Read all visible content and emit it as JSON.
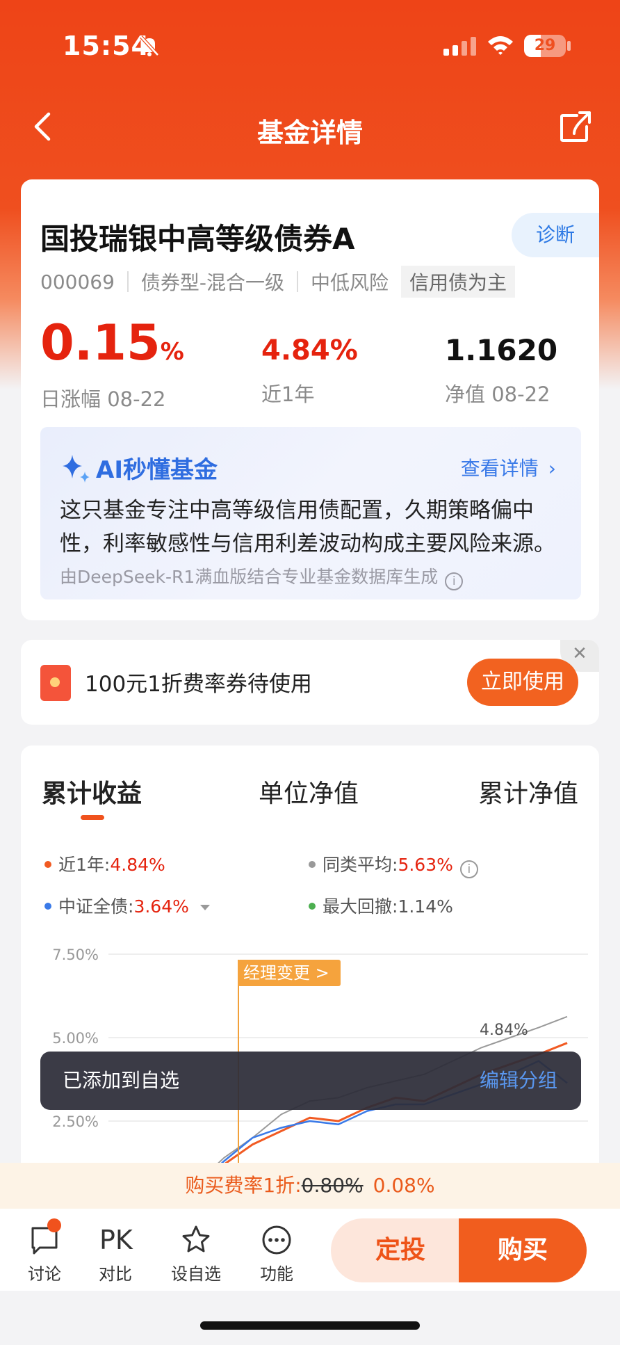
{
  "status_bar": {
    "time": "15:54",
    "battery": "29"
  },
  "nav": {
    "title": "基金详情"
  },
  "fund": {
    "name": "国投瑞银中高等级债券A",
    "diagnose_label": "诊断",
    "code": "000069",
    "type": "债券型-混合一级",
    "risk": "中低风险",
    "focus_tag": "信用债为主",
    "daily_change": "0.15",
    "daily_change_unit": "%",
    "daily_change_label": "日涨幅 08-22",
    "year_return": "4.84%",
    "year_return_label": "近1年",
    "nav_value": "1.1620",
    "nav_label": "净值 08-22"
  },
  "ai": {
    "title": "AI秒懂基金",
    "detail_link": "查看详情",
    "description": "这只基金专注中高等级信用债配置，久期策略偏中性，利率敏感性与信用利差波动构成主要风险来源。",
    "footnote": "由DeepSeek-R1满血版结合专业基金数据库生成"
  },
  "coupon": {
    "text": "100元1折费率券待使用",
    "button": "立即使用"
  },
  "chart_tabs": [
    "累计收益",
    "单位净值",
    "累计净值"
  ],
  "legend": {
    "item1_label": "近1年:",
    "item1_value": "4.84%",
    "item2_label": "同类平均:",
    "item2_value": "5.63%",
    "item3_label": "中证全债:",
    "item3_value": "3.64%",
    "item4_label": "最大回撤:",
    "item4_value": "1.14%"
  },
  "colors": {
    "fund": "#f15a22",
    "category_avg": "#999999",
    "index": "#3a7ae8",
    "drawdown": "#4caf50"
  },
  "chart_annotation": "经理变更 >",
  "chart_end_label": "4.84%",
  "chart_data": {
    "type": "line",
    "ylabel": "",
    "y_ticks": [
      "7.50%",
      "5.00%",
      "2.50%"
    ],
    "ylim": [
      0,
      7.5
    ],
    "grid": true,
    "series": [
      {
        "name": "近1年",
        "values": [
          0.0,
          0.4,
          1.2,
          1.8,
          2.2,
          2.6,
          2.5,
          2.9,
          3.2,
          3.1,
          3.5,
          3.9,
          4.2,
          4.5,
          4.84
        ]
      },
      {
        "name": "同类平均",
        "values": [
          0.0,
          0.6,
          1.4,
          2.0,
          2.7,
          3.1,
          3.2,
          3.5,
          3.7,
          3.9,
          4.3,
          4.7,
          5.0,
          5.3,
          5.63
        ]
      },
      {
        "name": "中证全债",
        "values": [
          0.0,
          0.5,
          1.3,
          2.0,
          2.3,
          2.5,
          2.4,
          2.8,
          3.0,
          3.0,
          3.3,
          3.6,
          3.9,
          4.3,
          3.64
        ]
      }
    ]
  },
  "toast": {
    "text": "已添加到自选",
    "link": "编辑分组"
  },
  "fee": {
    "prefix": "购买费率1折:",
    "old": "0.80%",
    "new": "0.08%"
  },
  "bottom": {
    "discuss": "讨论",
    "pk_icon": "PK",
    "compare": "对比",
    "watchlist": "设自选",
    "functions": "功能",
    "invest": "定投",
    "buy": "购买"
  }
}
